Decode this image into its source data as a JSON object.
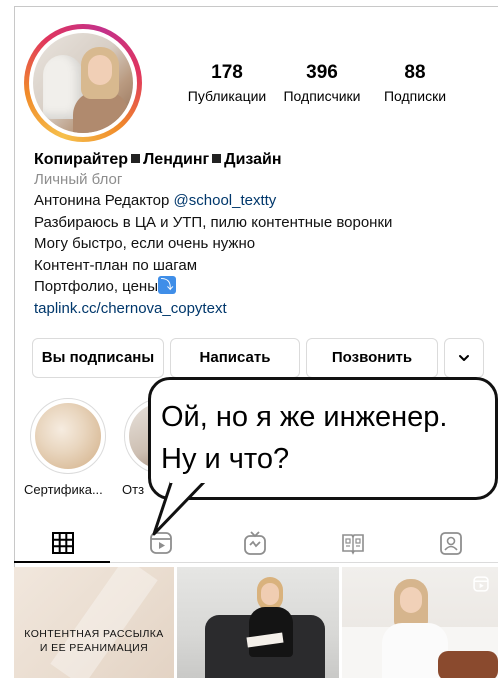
{
  "stats": {
    "posts": {
      "value": "178",
      "label": "Публикации"
    },
    "followers": {
      "value": "396",
      "label": "Подписчики"
    },
    "following": {
      "value": "88",
      "label": "Подписки"
    }
  },
  "bio": {
    "name_parts": [
      "Копирайтер",
      "Лендинг",
      "Дизайн"
    ],
    "category": "Личный блог",
    "line1_prefix": "Антонина Редактор ",
    "mention": "@school_textty",
    "line2": "Разбираюсь в ЦА и УТП, пилю контентные воронки",
    "line3": "Могу быстро, если очень нужно",
    "line4": "Контент-план по шагам",
    "line5": "Портфолио, цены",
    "line5_emoji": "⤵",
    "link": "taplink.cc/chernova_copytext"
  },
  "buttons": {
    "following": "Вы подписаны",
    "message": "Написать",
    "call": "Позвонить",
    "more_icon": "chevron-down-icon"
  },
  "highlights": [
    {
      "label": "Сертифика..."
    },
    {
      "label": "Отз"
    }
  ],
  "tabs": [
    {
      "icon": "grid-icon",
      "active": true
    },
    {
      "icon": "reels-icon",
      "active": false
    },
    {
      "icon": "igtv-icon",
      "active": false
    },
    {
      "icon": "guides-icon",
      "active": false
    },
    {
      "icon": "tagged-icon",
      "active": false
    }
  ],
  "posts": [
    {
      "caption_line1": "КОНТЕНТНАЯ РАССЫЛКА",
      "caption_line2": "И ЕЕ РЕАНИМАЦИЯ"
    },
    {
      "caption_line1": "",
      "caption_line2": ""
    },
    {
      "caption_line1": "",
      "caption_line2": ""
    }
  ],
  "bubble": {
    "line1": "Ой, но я же инженер.",
    "line2": "Ну и что?"
  },
  "colors": {
    "link": "#00376b",
    "muted": "#8e8e8e",
    "border": "#dbdbdb"
  }
}
